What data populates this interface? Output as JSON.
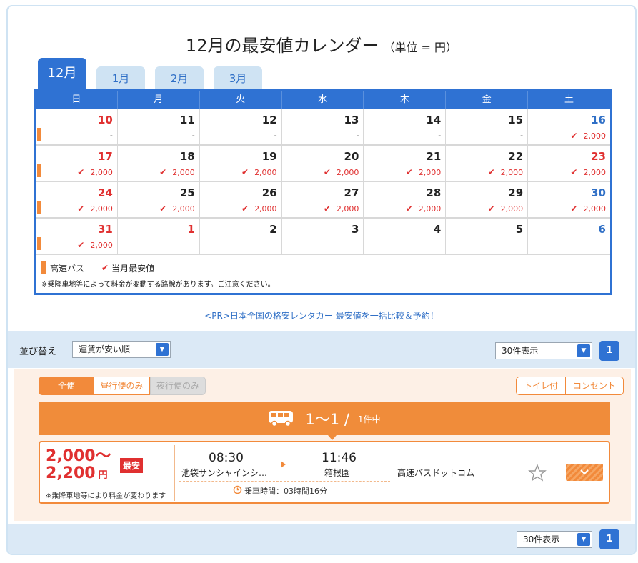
{
  "calendar": {
    "title": "12月の最安値カレンダー",
    "unit": "（単位 = 円）",
    "tabs": [
      {
        "label": "12月"
      },
      {
        "label": "1月"
      },
      {
        "label": "2月"
      },
      {
        "label": "3月"
      }
    ],
    "weekdays": [
      "日",
      "月",
      "火",
      "水",
      "木",
      "金",
      "土"
    ],
    "rows": [
      [
        {
          "day": "10",
          "color": "red",
          "bar": true,
          "price": "-",
          "check": false
        },
        {
          "day": "11",
          "color": "black",
          "bar": false,
          "price": "-",
          "check": false
        },
        {
          "day": "12",
          "color": "black",
          "bar": false,
          "price": "-",
          "check": false
        },
        {
          "day": "13",
          "color": "black",
          "bar": false,
          "price": "-",
          "check": false
        },
        {
          "day": "14",
          "color": "black",
          "bar": false,
          "price": "-",
          "check": false
        },
        {
          "day": "15",
          "color": "black",
          "bar": false,
          "price": "-",
          "check": false
        },
        {
          "day": "16",
          "color": "blue",
          "bar": false,
          "price": "2,000",
          "check": true
        }
      ],
      [
        {
          "day": "17",
          "color": "red",
          "bar": true,
          "price": "2,000",
          "check": true
        },
        {
          "day": "18",
          "color": "black",
          "bar": false,
          "price": "2,000",
          "check": true
        },
        {
          "day": "19",
          "color": "black",
          "bar": false,
          "price": "2,000",
          "check": true
        },
        {
          "day": "20",
          "color": "black",
          "bar": false,
          "price": "2,000",
          "check": true
        },
        {
          "day": "21",
          "color": "black",
          "bar": false,
          "price": "2,000",
          "check": true
        },
        {
          "day": "22",
          "color": "black",
          "bar": false,
          "price": "2,000",
          "check": true
        },
        {
          "day": "23",
          "color": "red",
          "bar": false,
          "price": "2,000",
          "check": true
        }
      ],
      [
        {
          "day": "24",
          "color": "red",
          "bar": true,
          "price": "2,000",
          "check": true
        },
        {
          "day": "25",
          "color": "black",
          "bar": false,
          "price": "2,000",
          "check": true
        },
        {
          "day": "26",
          "color": "black",
          "bar": false,
          "price": "2,000",
          "check": true
        },
        {
          "day": "27",
          "color": "black",
          "bar": false,
          "price": "2,000",
          "check": true
        },
        {
          "day": "28",
          "color": "black",
          "bar": false,
          "price": "2,000",
          "check": true
        },
        {
          "day": "29",
          "color": "black",
          "bar": false,
          "price": "2,000",
          "check": true
        },
        {
          "day": "30",
          "color": "blue",
          "bar": false,
          "price": "2,000",
          "check": true
        }
      ],
      [
        {
          "day": "31",
          "color": "red",
          "bar": true,
          "price": "2,000",
          "check": true
        },
        {
          "day": "1",
          "color": "red",
          "bar": false,
          "price": "",
          "check": false
        },
        {
          "day": "2",
          "color": "black",
          "bar": false,
          "price": "",
          "check": false
        },
        {
          "day": "3",
          "color": "black",
          "bar": false,
          "price": "",
          "check": false
        },
        {
          "day": "4",
          "color": "black",
          "bar": false,
          "price": "",
          "check": false
        },
        {
          "day": "5",
          "color": "black",
          "bar": false,
          "price": "",
          "check": false
        },
        {
          "day": "6",
          "color": "blue",
          "bar": false,
          "price": "",
          "check": false
        }
      ]
    ],
    "legend": {
      "bus_label": "高速バス",
      "cheapest_label": "当月最安値",
      "note": "※乗降車地等によって料金が変動する路線があります。ご注意ください。"
    }
  },
  "pr_link": "<PR>日本全国の格安レンタカー 最安値を一括比較＆予約！",
  "sort": {
    "label": "並び替え",
    "selected": "運賃が安い順",
    "per_page": "30件表示",
    "page": "1"
  },
  "filters": {
    "all": "全便",
    "day": "昼行便のみ",
    "night": "夜行便のみ",
    "toilet": "トイレ付",
    "outlet": "コンセント"
  },
  "count": {
    "range": "1〜1 /",
    "total": "1件中"
  },
  "result": {
    "price_line1": "2,000〜",
    "price_line2": "2,200",
    "yen": "円",
    "badge": "最安",
    "note": "※乗降車地等により料金が変わります",
    "dep_time": "08:30",
    "dep_place": "池袋サンシャインシ…",
    "arr_time": "11:46",
    "arr_place": "箱根園",
    "ride_time": "乗車時間：03時間16分",
    "company": "高速バスドットコム"
  },
  "bottom": {
    "per_page": "30件表示",
    "page": "1"
  },
  "colors": {
    "primary_blue": "#2f72d3",
    "accent_orange": "#f28a3b",
    "price_red": "#e03030"
  }
}
